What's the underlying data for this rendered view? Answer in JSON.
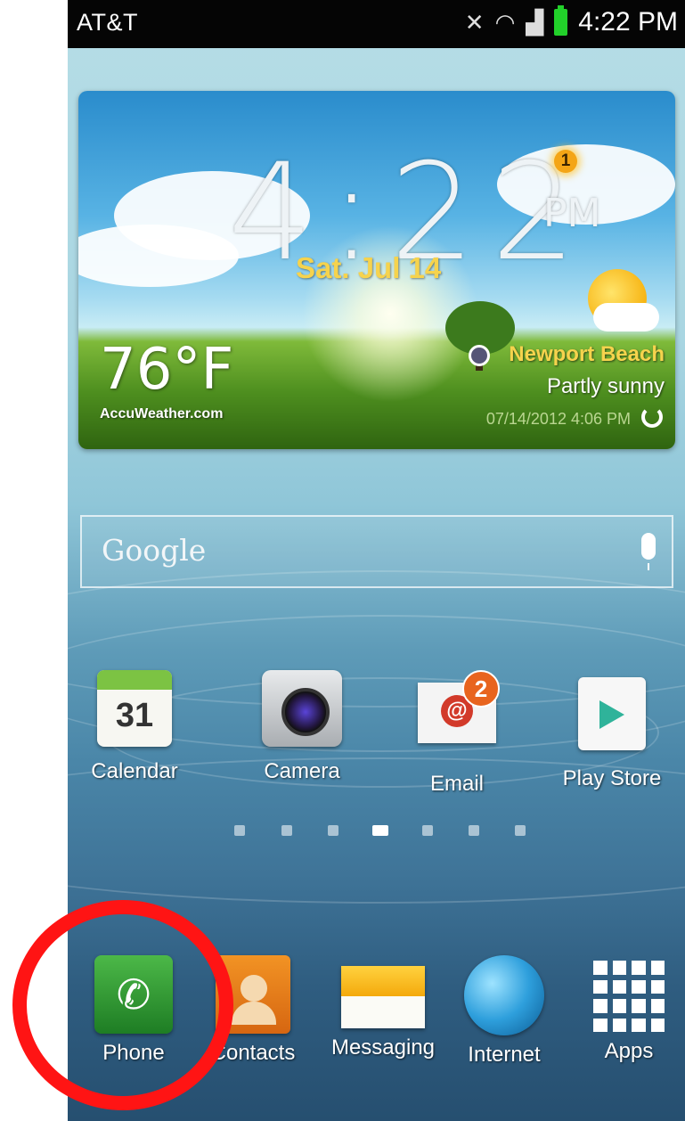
{
  "statusbar": {
    "carrier": "AT&T",
    "time": "4:22 PM",
    "icons": [
      "mute-icon",
      "wifi-icon",
      "signal-icon",
      "battery-icon"
    ]
  },
  "widget": {
    "clock": "4:22",
    "ampm": "PM",
    "date": "Sat. Jul 14",
    "alert_count": "1",
    "temperature": "76°F",
    "provider": "AccuWeather.com",
    "city": "Newport Beach",
    "condition": "Partly sunny",
    "updated": "07/14/2012 4:06 PM"
  },
  "search": {
    "label": "Google"
  },
  "apps": [
    {
      "label": "Calendar",
      "icon": "calendar-icon",
      "day": "31"
    },
    {
      "label": "Camera",
      "icon": "camera-icon"
    },
    {
      "label": "Email",
      "icon": "email-icon",
      "badge": "2",
      "glyph": "@"
    },
    {
      "label": "Play Store",
      "icon": "play-store-icon"
    }
  ],
  "pager": {
    "pages": 7,
    "current": 4
  },
  "dock": [
    {
      "label": "Phone",
      "icon": "phone-icon"
    },
    {
      "label": "Contacts",
      "icon": "contacts-icon"
    },
    {
      "label": "Messaging",
      "icon": "messaging-icon"
    },
    {
      "label": "Internet",
      "icon": "internet-icon"
    },
    {
      "label": "Apps",
      "icon": "apps-grid-icon"
    }
  ],
  "colors": {
    "annotation": "#ff1414",
    "date_text": "#f6d34d",
    "statusbar_bg": "#050505"
  }
}
